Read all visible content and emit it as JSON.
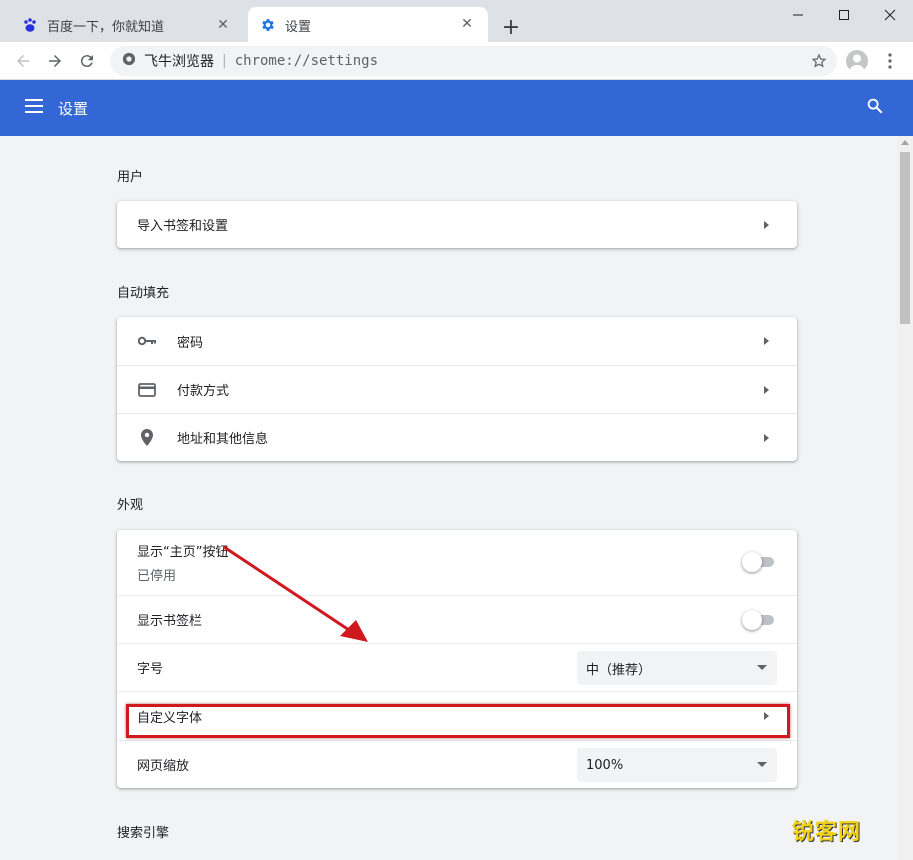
{
  "tabs": [
    {
      "title": "百度一下，你就知道",
      "favicon": "baidu-paw-icon",
      "active": false
    },
    {
      "title": "设置",
      "favicon": "gear-icon",
      "active": true
    }
  ],
  "omnibox": {
    "site_label": "飞牛浏览器",
    "url": "chrome://settings"
  },
  "header": {
    "title": "设置"
  },
  "sections": {
    "user": {
      "title": "用户",
      "rows": [
        {
          "label": "导入书签和设置"
        }
      ]
    },
    "autofill": {
      "title": "自动填充",
      "rows": [
        {
          "label": "密码",
          "icon": "key-icon"
        },
        {
          "label": "付款方式",
          "icon": "credit-card-icon"
        },
        {
          "label": "地址和其他信息",
          "icon": "location-pin-icon"
        }
      ]
    },
    "appearance": {
      "title": "外观",
      "rows": [
        {
          "label": "显示“主页”按钮",
          "sub": "已停用",
          "toggle_on": false
        },
        {
          "label": "显示书签栏",
          "toggle_on": false
        },
        {
          "label": "字号",
          "select_value": "中（推荐）"
        },
        {
          "label": "自定义字体"
        },
        {
          "label": "网页缩放",
          "select_value": "100%"
        }
      ]
    },
    "search": {
      "title": "搜索引擎"
    }
  },
  "watermark": {
    "brand": "锐客网"
  },
  "colors": {
    "header_blue": "#3367d6",
    "annotation_red": "#d0181f"
  }
}
